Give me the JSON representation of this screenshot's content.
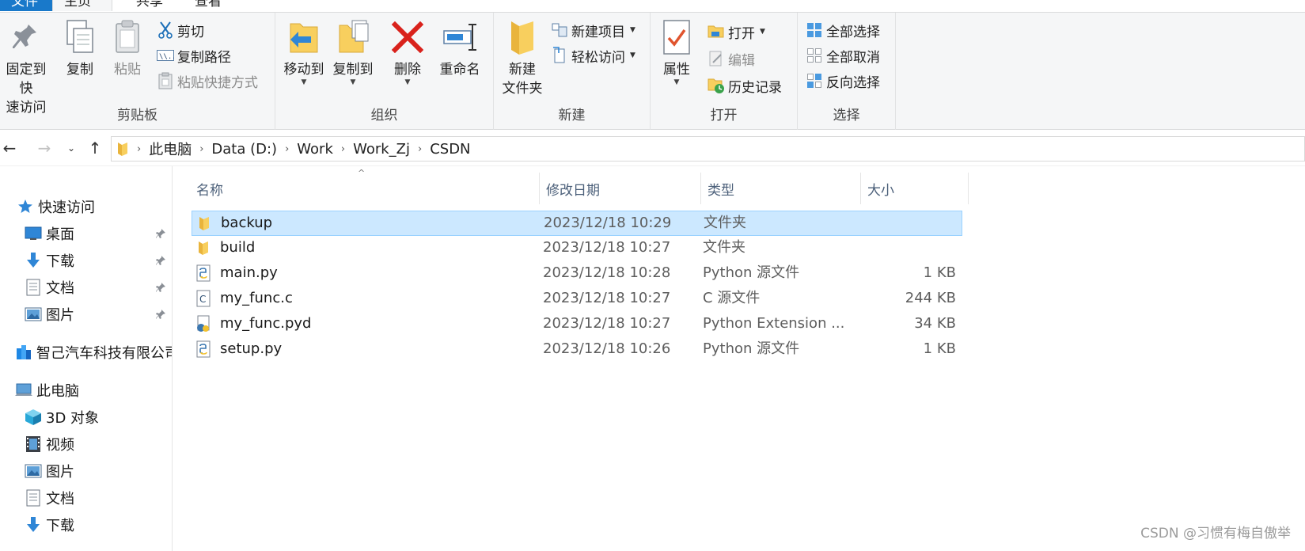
{
  "tabs": [
    "文件",
    "主页",
    "共享",
    "查看"
  ],
  "ribbon": {
    "clipboard": {
      "label": "剪贴板",
      "pin_line1": "固定到快",
      "pin_line2": "速访问",
      "copy": "复制",
      "paste": "粘贴",
      "cut": "剪切",
      "copy_path": "复制路径",
      "paste_shortcut": "粘贴快捷方式"
    },
    "organize": {
      "label": "组织",
      "move_to": "移动到",
      "copy_to": "复制到",
      "delete": "删除",
      "rename": "重命名"
    },
    "new": {
      "label": "新建",
      "new_folder_line1": "新建",
      "new_folder_line2": "文件夹",
      "new_item": "新建项目",
      "easy_access": "轻松访问"
    },
    "open": {
      "label": "打开",
      "properties": "属性",
      "open": "打开",
      "edit": "编辑",
      "history": "历史记录"
    },
    "select": {
      "label": "选择",
      "select_all": "全部选择",
      "select_none": "全部取消",
      "invert": "反向选择"
    }
  },
  "address": {
    "crumbs": [
      "此电脑",
      "Data (D:)",
      "Work",
      "Work_Zj",
      "CSDN"
    ]
  },
  "navpane": {
    "quick_access": "快速访问",
    "desktop": "桌面",
    "downloads": "下载",
    "documents": "文档",
    "pictures": "图片",
    "company": "智己汽车科技有限公司",
    "this_pc": "此电脑",
    "objects3d": "3D 对象",
    "videos": "视频",
    "pictures2": "图片",
    "documents2": "文档",
    "downloads2": "下载"
  },
  "columns": {
    "name": "名称",
    "date": "修改日期",
    "type": "类型",
    "size": "大小"
  },
  "files": [
    {
      "name": "backup",
      "date": "2023/12/18 10:29",
      "type": "文件夹",
      "size": "",
      "icon": "folder-icon"
    },
    {
      "name": "build",
      "date": "2023/12/18 10:27",
      "type": "文件夹",
      "size": "",
      "icon": "folder-icon"
    },
    {
      "name": "main.py",
      "date": "2023/12/18 10:28",
      "type": "Python 源文件",
      "size": "1 KB",
      "icon": "python-file-icon"
    },
    {
      "name": "my_func.c",
      "date": "2023/12/18 10:27",
      "type": "C 源文件",
      "size": "244 KB",
      "icon": "c-file-icon"
    },
    {
      "name": "my_func.pyd",
      "date": "2023/12/18 10:27",
      "type": "Python Extension ...",
      "size": "34 KB",
      "icon": "python-extension-icon"
    },
    {
      "name": "setup.py",
      "date": "2023/12/18 10:26",
      "type": "Python 源文件",
      "size": "1 KB",
      "icon": "python-file-icon"
    }
  ],
  "watermark": "CSDN @习惯有梅自傲举",
  "colors": {
    "accent": "#1979ca",
    "selection": "#cce8ff",
    "folder": "#f8cf5e"
  }
}
